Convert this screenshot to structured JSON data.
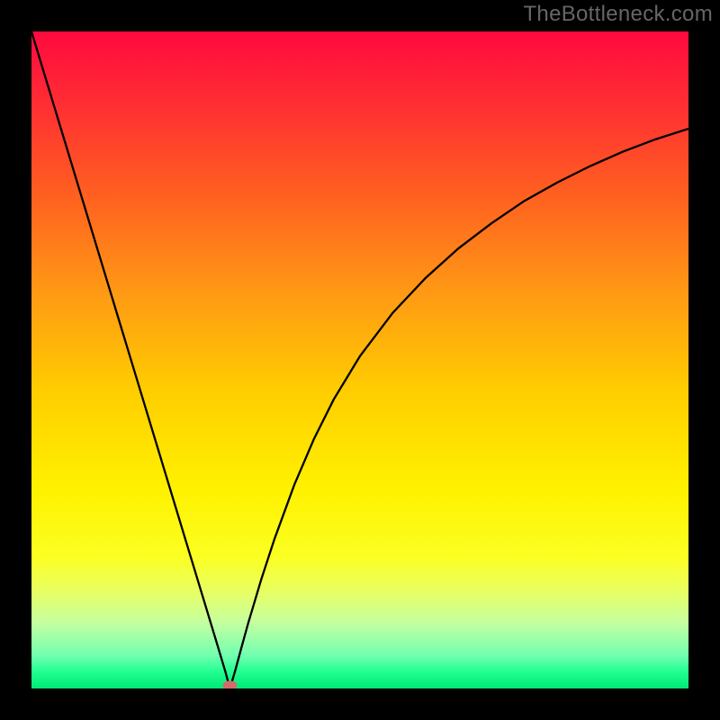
{
  "watermark": "TheBottleneck.com",
  "chart_data": {
    "type": "line",
    "title": "",
    "xlabel": "",
    "ylabel": "",
    "xlim": [
      0,
      100
    ],
    "ylim": [
      0,
      100
    ],
    "grid": false,
    "background_gradient": {
      "stops": [
        {
          "offset": 0.0,
          "color": "#ff0a3e"
        },
        {
          "offset": 0.1,
          "color": "#ff2a34"
        },
        {
          "offset": 0.25,
          "color": "#ff6020"
        },
        {
          "offset": 0.4,
          "color": "#ff9a14"
        },
        {
          "offset": 0.55,
          "color": "#ffce00"
        },
        {
          "offset": 0.7,
          "color": "#fff200"
        },
        {
          "offset": 0.8,
          "color": "#fbff22"
        },
        {
          "offset": 0.85,
          "color": "#eaff60"
        },
        {
          "offset": 0.9,
          "color": "#c4ffa0"
        },
        {
          "offset": 0.95,
          "color": "#72ffb0"
        },
        {
          "offset": 0.975,
          "color": "#20ff90"
        },
        {
          "offset": 1.0,
          "color": "#00e878"
        }
      ]
    },
    "series": [
      {
        "name": "bottleneck-curve",
        "stroke": "#000000",
        "stroke_width": 2.3,
        "x": [
          0.0,
          2,
          4,
          6,
          8,
          10,
          12,
          14,
          16,
          18,
          20,
          22,
          24,
          26,
          28,
          29.5,
          30.2,
          31,
          32,
          33,
          35,
          37,
          40,
          43,
          46,
          50,
          55,
          60,
          65,
          70,
          75,
          80,
          85,
          90,
          95,
          100
        ],
        "y": [
          100,
          93.4,
          86.8,
          80.2,
          73.6,
          67.0,
          60.4,
          53.8,
          47.2,
          40.6,
          34.0,
          27.4,
          20.8,
          14.2,
          7.6,
          2.6,
          0.0,
          2.7,
          6.4,
          10.0,
          16.7,
          22.8,
          31.0,
          38.0,
          44.0,
          50.6,
          57.2,
          62.5,
          67.0,
          70.8,
          74.2,
          77.0,
          79.5,
          81.7,
          83.6,
          85.2
        ]
      }
    ],
    "marker": {
      "x": 30.2,
      "y": 0.5,
      "color": "#d46a6a",
      "rx": 8,
      "ry": 5
    }
  }
}
